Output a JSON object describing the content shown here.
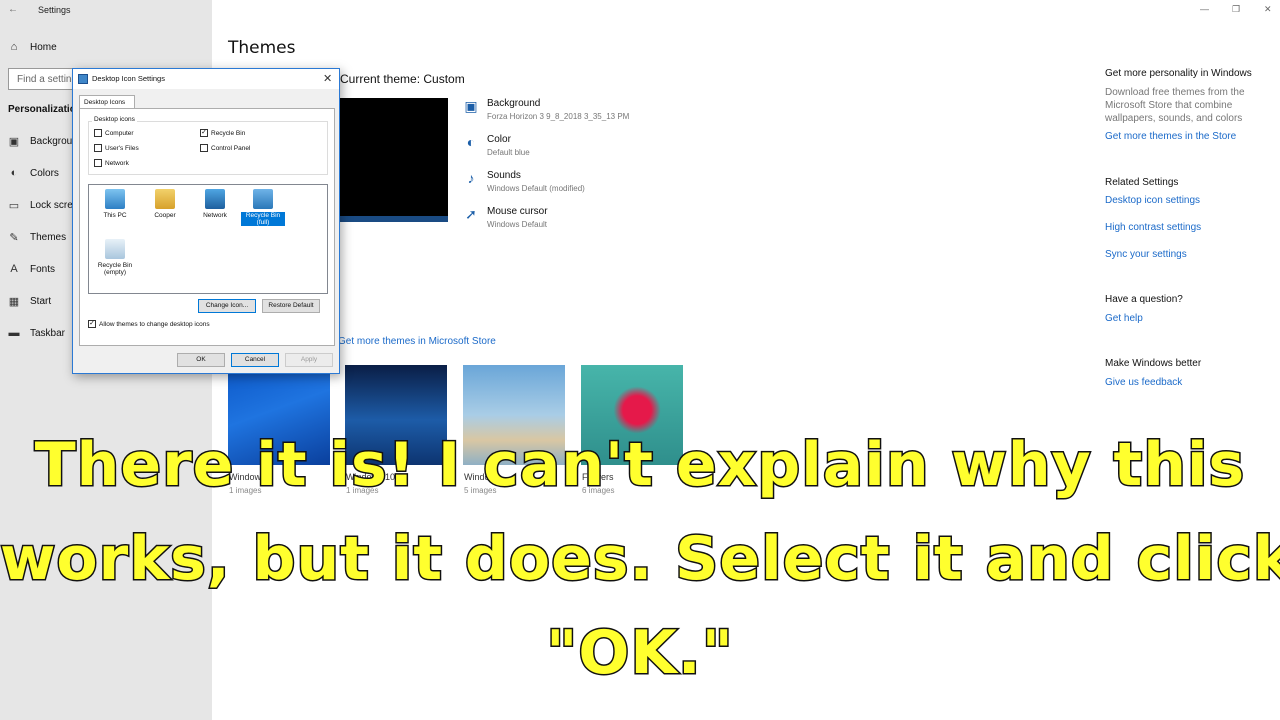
{
  "window": {
    "app_title": "Settings",
    "back_icon": "back-arrow-icon",
    "minimize_glyph": "—",
    "maximize_glyph": "❐",
    "close_glyph": "✕"
  },
  "sidebar": {
    "home": {
      "label": "Home",
      "icon": "home-icon"
    },
    "search_placeholder": "Find a setting",
    "section": "Personalization",
    "items": [
      {
        "label": "Background",
        "icon": "picture-icon"
      },
      {
        "label": "Colors",
        "icon": "palette-icon"
      },
      {
        "label": "Lock screen",
        "icon": "monitor-icon"
      },
      {
        "label": "Themes",
        "icon": "brush-icon"
      },
      {
        "label": "Fonts",
        "icon": "font-icon"
      },
      {
        "label": "Start",
        "icon": "start-grid-icon"
      },
      {
        "label": "Taskbar",
        "icon": "taskbar-icon"
      }
    ]
  },
  "main": {
    "title": "Themes",
    "current_theme": "Current theme: Custom",
    "properties": [
      {
        "label": "Background",
        "value": "Forza Horizon 3 9_8_2018 3_35_13 PM",
        "icon": "picture-icon"
      },
      {
        "label": "Color",
        "value": "Default blue",
        "icon": "palette-icon"
      },
      {
        "label": "Sounds",
        "value": "Windows Default (modified)",
        "icon": "speaker-icon"
      },
      {
        "label": "Mouse cursor",
        "value": "Windows Default",
        "icon": "cursor-icon"
      }
    ],
    "store_link": "Get more themes in Microsoft Store",
    "themes": [
      {
        "name": "Windows",
        "count": "1 images"
      },
      {
        "name": "Windows 10",
        "count": "1 images"
      },
      {
        "name": "Windows",
        "count": "5 images"
      },
      {
        "name": "Flowers",
        "count": "6 images"
      }
    ]
  },
  "right": {
    "personality_heading": "Get more personality in Windows",
    "personality_text": "Download free themes from the Microsoft Store that combine wallpapers, sounds, and colors",
    "personality_link": "Get more themes in the Store",
    "related_heading": "Related Settings",
    "related_links": [
      "Desktop icon settings",
      "High contrast settings",
      "Sync your settings"
    ],
    "question_heading": "Have a question?",
    "question_link": "Get help",
    "better_heading": "Make Windows better",
    "better_link": "Give us feedback"
  },
  "dialog": {
    "title": "Desktop Icon Settings",
    "tab": "Desktop Icons",
    "group_title": "Desktop icons",
    "checkboxes": [
      {
        "label": "Computer",
        "checked": false
      },
      {
        "label": "Recycle Bin",
        "checked": true
      },
      {
        "label": "User's Files",
        "checked": false
      },
      {
        "label": "Control Panel",
        "checked": false
      },
      {
        "label": "Network",
        "checked": false
      }
    ],
    "icons": [
      {
        "label": "This PC",
        "icon": "this-pc-icon",
        "selected": false
      },
      {
        "label": "Cooper",
        "icon": "user-folder-icon",
        "selected": false
      },
      {
        "label": "Network",
        "icon": "network-icon",
        "selected": false
      },
      {
        "label": "Recycle Bin\n(full)",
        "icon": "recycle-bin-full-icon",
        "selected": true
      },
      {
        "label": "Recycle Bin\n(empty)",
        "icon": "recycle-bin-empty-icon",
        "selected": false
      }
    ],
    "change_icon": "Change Icon...",
    "restore_default": "Restore Default",
    "allow_themes": "Allow themes to change desktop icons",
    "allow_themes_checked": true,
    "ok": "OK",
    "cancel": "Cancel",
    "apply": "Apply"
  },
  "caption": {
    "line1": "There it is! I can't explain why this",
    "line2": "works, but it does. Select it and click",
    "line3": "\"OK.\""
  },
  "colors": {
    "accent": "#0078d7",
    "link": "#1b6ac9",
    "caption_fill": "#ffff2e",
    "caption_outline": "#111111"
  }
}
